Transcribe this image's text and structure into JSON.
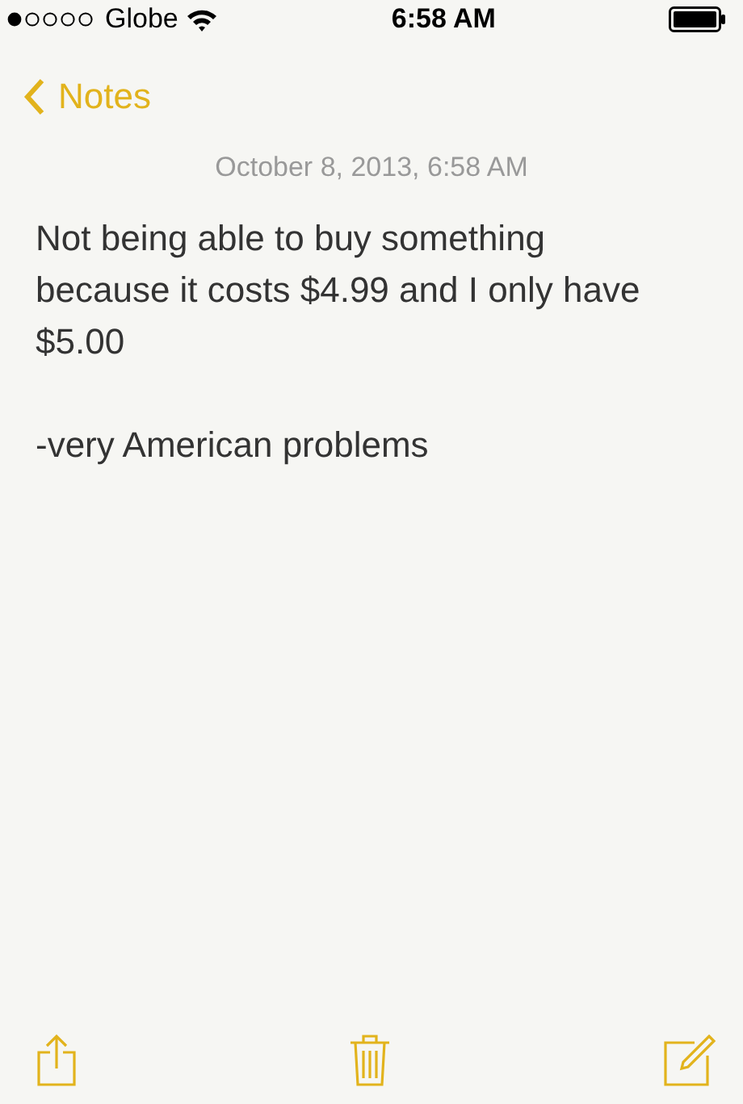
{
  "status_bar": {
    "carrier": "Globe",
    "time": "6:58 AM"
  },
  "nav": {
    "back": "Notes"
  },
  "note": {
    "date": "October 8, 2013, 6:58 AM",
    "paragraphs": [
      "Not being able to buy something because it costs $4.99 and I only have $5.00",
      "-very American problems"
    ]
  }
}
